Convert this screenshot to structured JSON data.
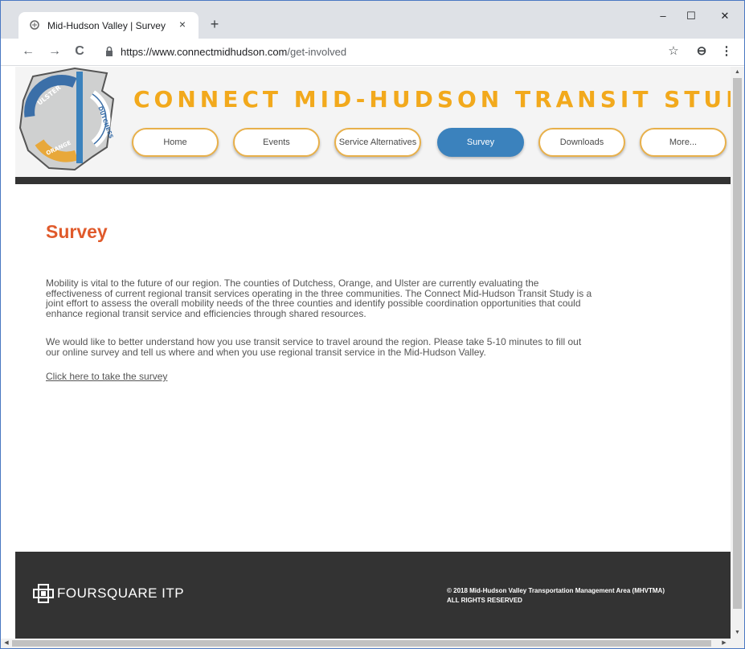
{
  "browser": {
    "tab_title": "Mid-Hudson Valley | Survey",
    "tab_close": "×",
    "new_tab": "+",
    "minimize": "–",
    "maximize": "☐",
    "close": "✕",
    "url_host": "https://www.connectmidhudson.com",
    "url_path": "/get-involved",
    "back": "←",
    "forward": "→",
    "reload": "C",
    "bookmark": "☆",
    "account": "⊖",
    "menu": "⋮"
  },
  "logo": {
    "ulster": "ULSTER",
    "dutchess": "DUTCHESS",
    "orange": "ORANGE"
  },
  "header": {
    "title": "CONNECT MID-HUDSON TRANSIT STUDY",
    "nav": [
      {
        "label": "Home",
        "active": false
      },
      {
        "label": "Events",
        "active": false
      },
      {
        "label": "Service Alternatives",
        "active": false
      },
      {
        "label": "Survey",
        "active": true
      },
      {
        "label": "Downloads",
        "active": false
      },
      {
        "label": "More...",
        "active": false
      }
    ]
  },
  "content": {
    "heading": "Survey",
    "paragraph1": "Mobility is vital to the future of our region. The counties of Dutchess, Orange, and Ulster are currently evaluating the effectiveness of current regional transit services operating in the three communities. The Connect Mid-Hudson Transit Study is a joint effort to assess the overall mobility needs of the three counties and identify possible coordination opportunities that could enhance regional transit service and efficiencies through shared resources.",
    "paragraph2": "We would like to better understand how you use transit service to travel around the region. Please take 5-10 minutes to fill out our online survey and tell us where and when you use regional transit service in the Mid-Hudson Valley.",
    "survey_link": "Click here to take the survey"
  },
  "footer": {
    "brand": "FOURSQUARE ITP",
    "copyright_line1": "© 2018 Mid-Hudson Valley Transportation Management Area (MHVTMA)",
    "copyright_line2": "ALL RIGHTS RESERVED"
  },
  "colors": {
    "title_orange": "#f2a91c",
    "heading_red": "#e05a2b",
    "nav_active_blue": "#3b82bd",
    "footer_dark": "#333333"
  }
}
